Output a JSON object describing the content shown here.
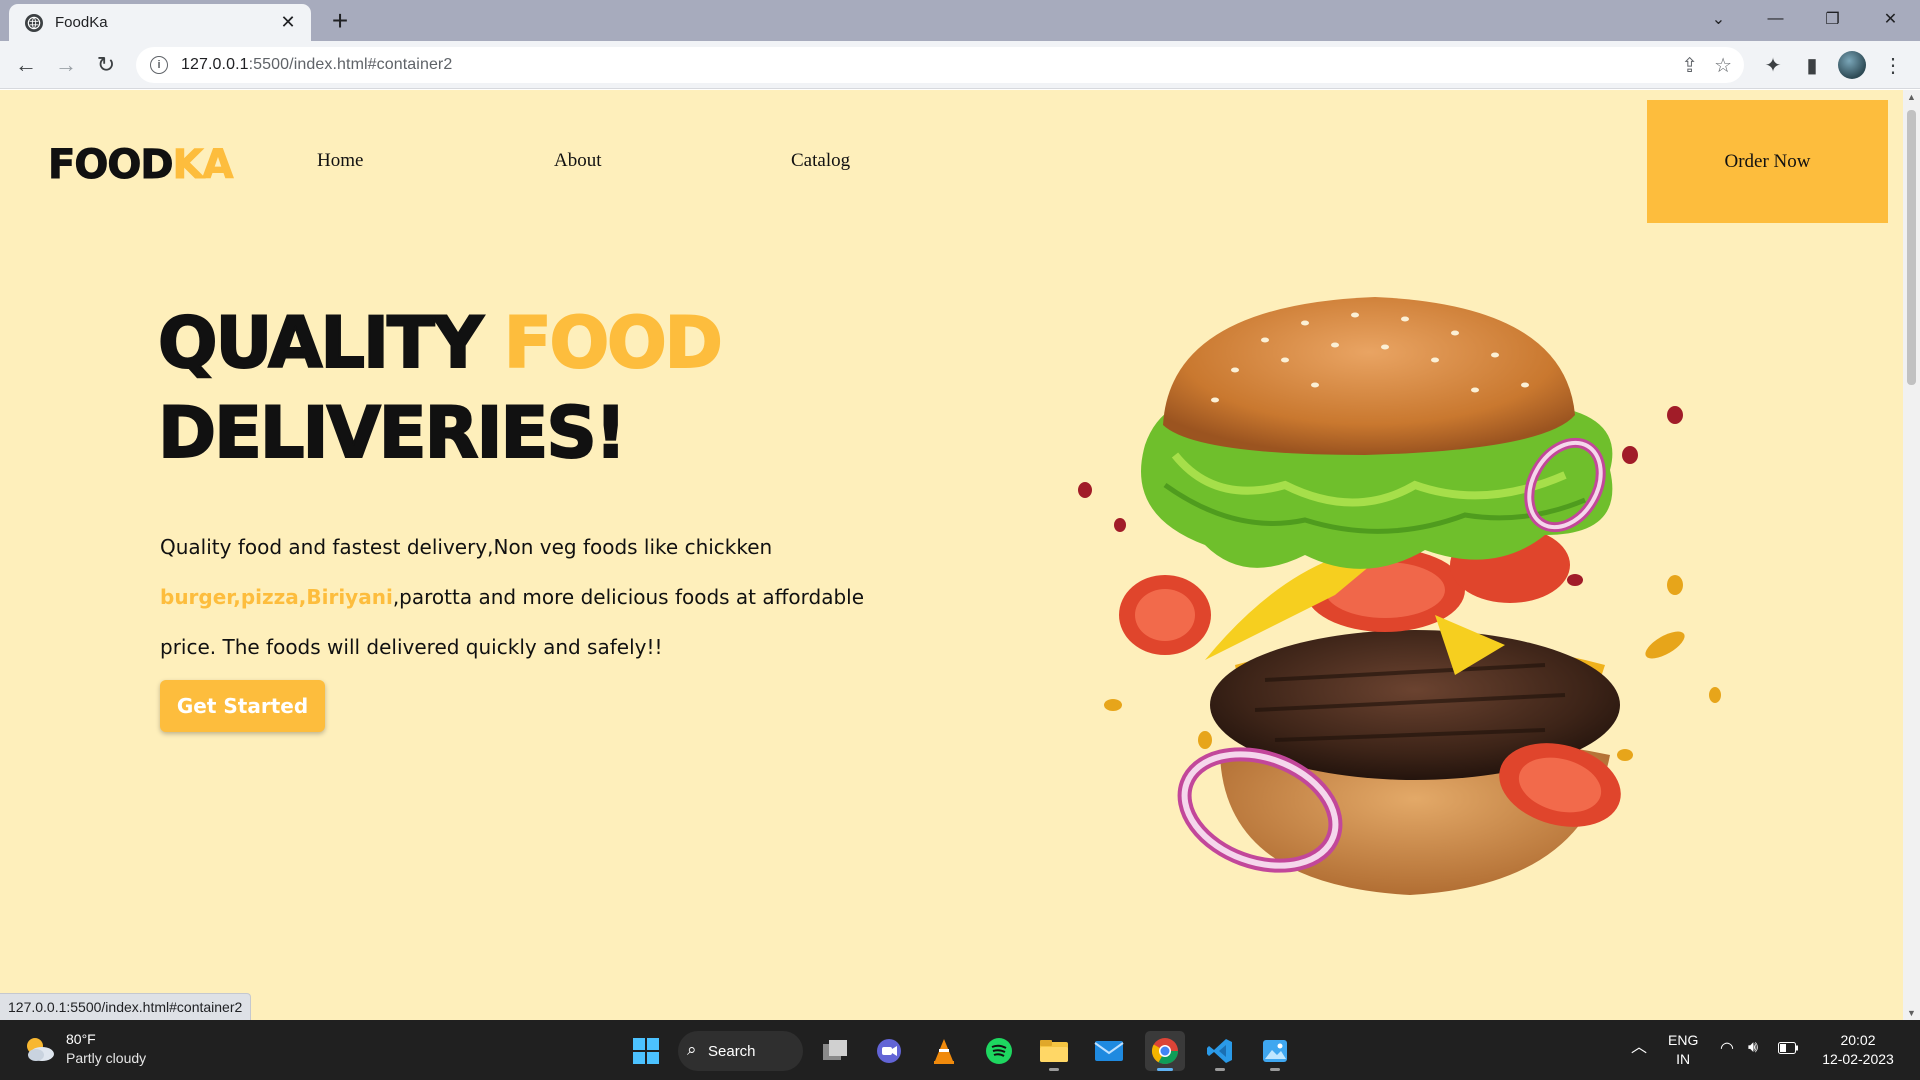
{
  "browser": {
    "tab_title": "FoodKa",
    "tab_close": "✕",
    "new_tab": "+",
    "url_host": "127.0.0.1",
    "url_rest": ":5500/index.html#container2",
    "status_url": "127.0.0.1:5500/index.html#container2"
  },
  "page": {
    "logo_main": "FOOD",
    "logo_accent": "KA",
    "nav": [
      "Home",
      "About",
      "Catalog"
    ],
    "order_button": "Order Now",
    "hero_line1_a": "QUALITY ",
    "hero_line1_b": "FOOD",
    "hero_line2": "DELIVERIES!",
    "desc_1": "Quality food and fastest delivery,Non veg foods like chickken",
    "desc_highlight": "burger,pizza,Biriyani",
    "desc_2": ",parotta and more delicious foods at affordable",
    "desc_3": "price. The foods will delivered quickly and safely!!",
    "cta": "Get Started"
  },
  "taskbar": {
    "temperature": "80°F",
    "weather": "Partly cloudy",
    "search": "Search",
    "lang_1": "ENG",
    "lang_2": "IN",
    "time": "20:02",
    "date": "12-02-2023"
  },
  "colors": {
    "page_bg": "#feefbb",
    "accent": "#fdbd3d",
    "text": "#111111",
    "taskbar": "#202020"
  }
}
